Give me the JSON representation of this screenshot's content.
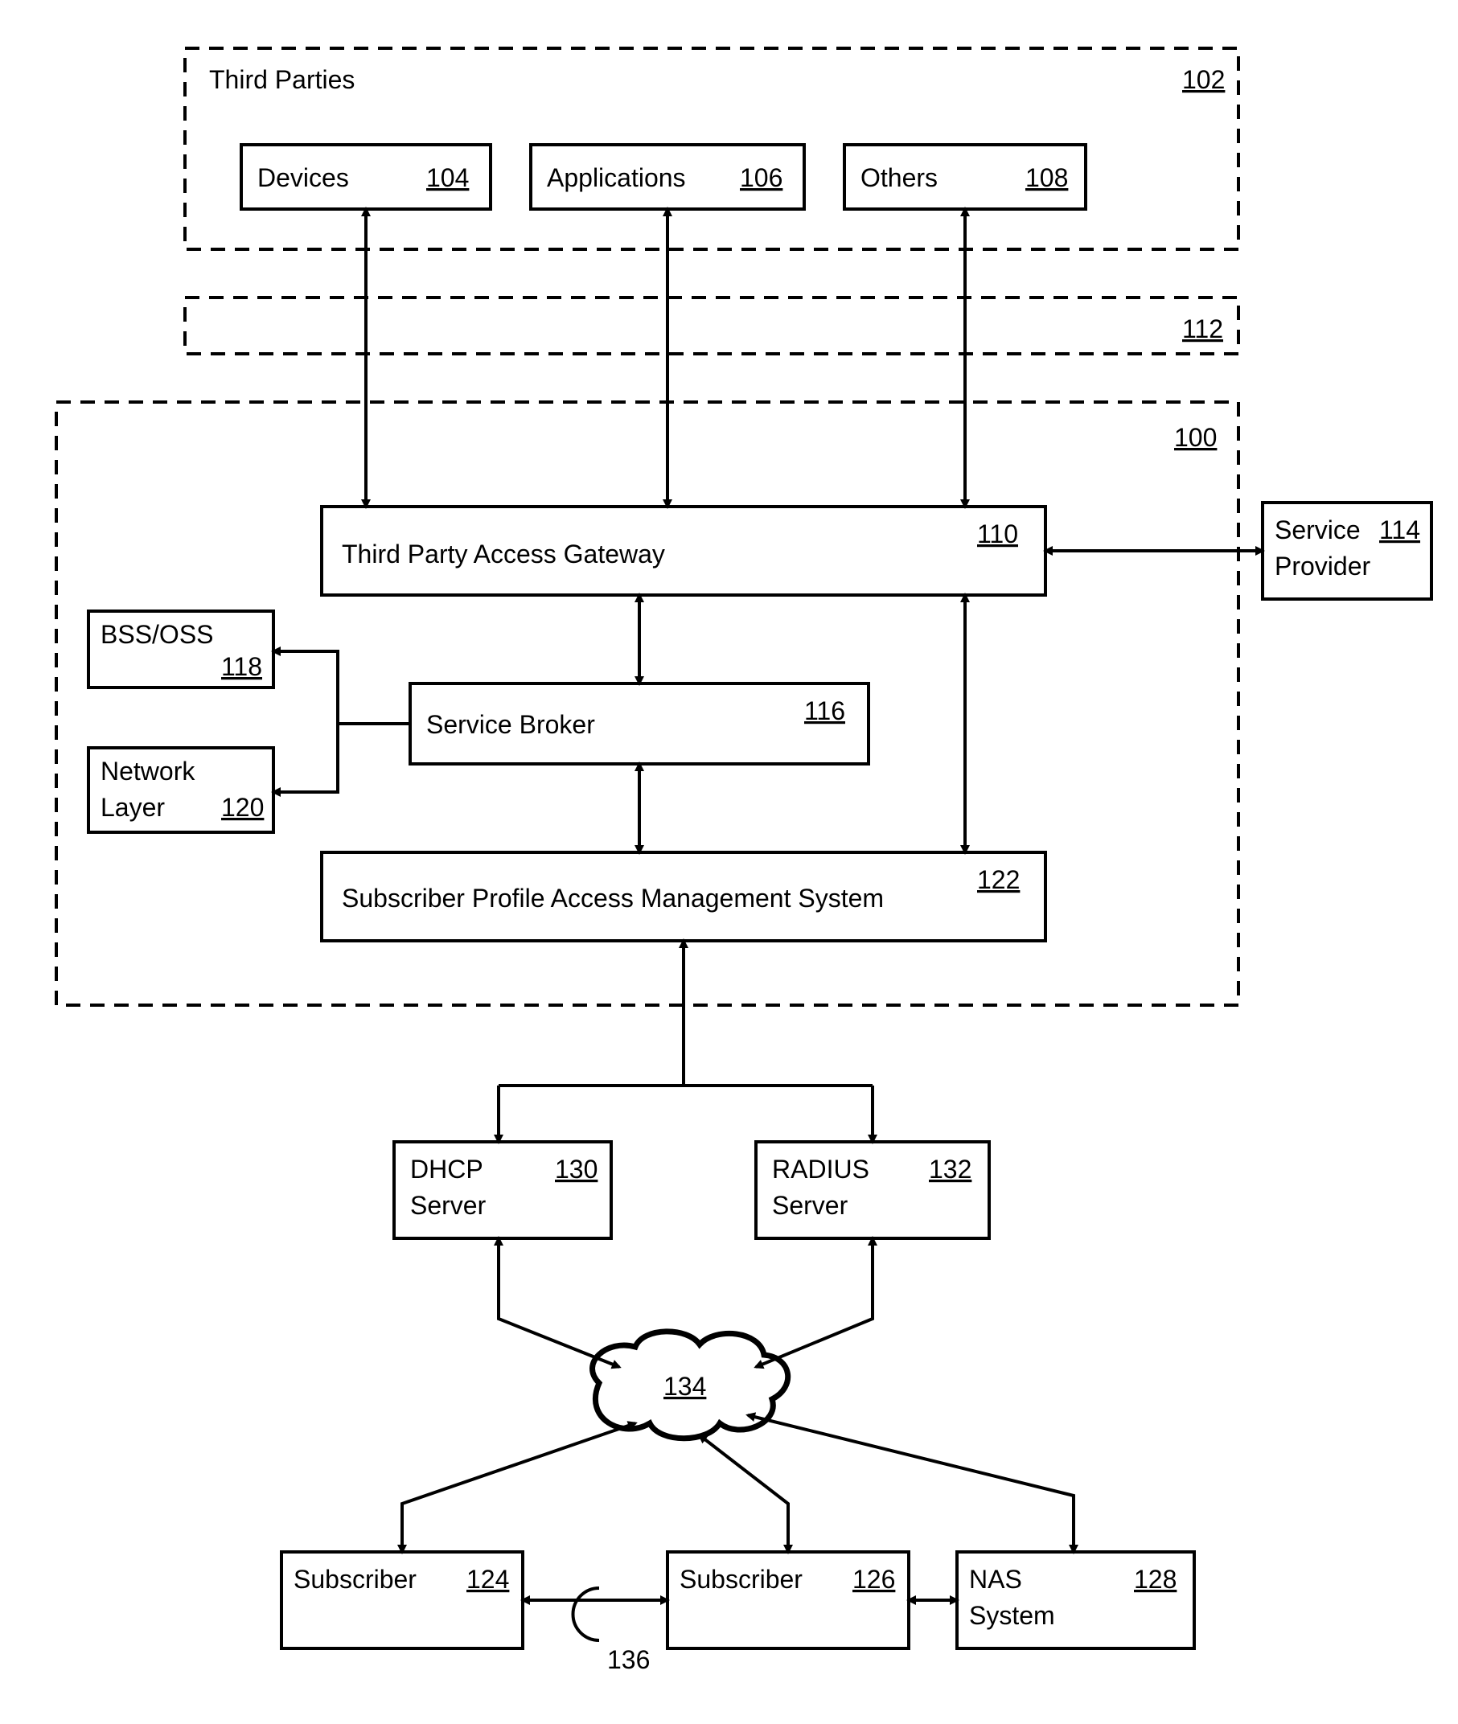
{
  "thirdParties": {
    "title": "Third Parties",
    "num": "102",
    "devices": {
      "label": "Devices",
      "num": "104"
    },
    "applications": {
      "label": "Applications",
      "num": "106"
    },
    "others": {
      "label": "Others",
      "num": "108"
    }
  },
  "gap": {
    "num": "112"
  },
  "main": {
    "num": "100",
    "gateway": {
      "label": "Third Party Access Gateway",
      "num": "110"
    },
    "serviceProvider": {
      "label1": "Service",
      "label2": "Provider",
      "num": "114"
    },
    "bssoss": {
      "label": "BSS/OSS",
      "num": "118"
    },
    "network": {
      "label1": "Network",
      "label2": "Layer",
      "num": "120"
    },
    "broker": {
      "label": "Service Broker",
      "num": "116"
    },
    "spams": {
      "label": "Subscriber Profile Access Management System",
      "num": "122"
    }
  },
  "lower": {
    "dhcp": {
      "label1": "DHCP",
      "label2": "Server",
      "num": "130"
    },
    "radius": {
      "label1": "RADIUS",
      "label2": "Server",
      "num": "132"
    },
    "cloud": {
      "num": "134"
    },
    "sub1": {
      "label": "Subscriber",
      "num": "124"
    },
    "sub2": {
      "label": "Subscriber",
      "num": "126"
    },
    "nas": {
      "label1": "NAS",
      "label2": "System",
      "num": "128"
    },
    "swap": {
      "num": "136"
    }
  }
}
